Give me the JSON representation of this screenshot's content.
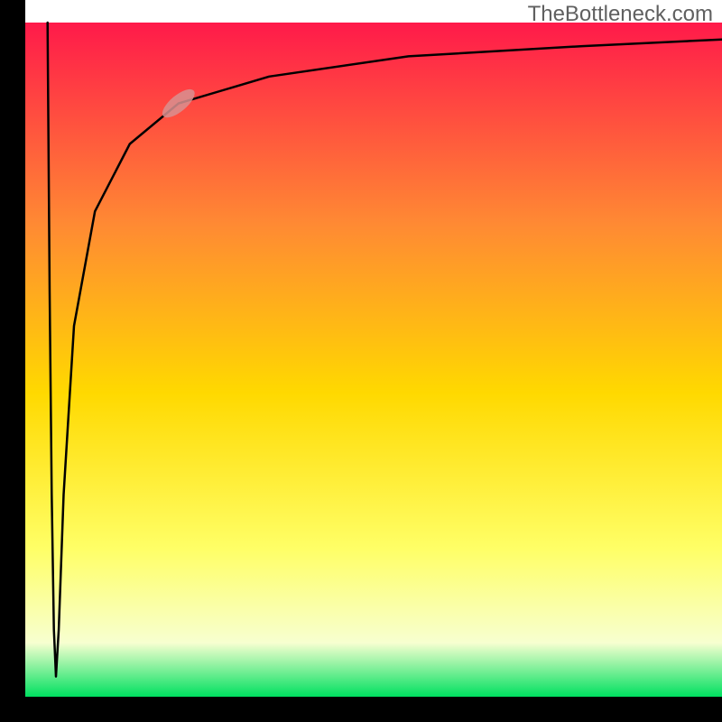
{
  "watermark": "TheBottleneck.com",
  "chart_data": {
    "type": "line",
    "title": "",
    "xlabel": "",
    "ylabel": "",
    "xlim": [
      0,
      100
    ],
    "ylim": [
      0,
      100
    ],
    "background_gradient": {
      "top": "#ff1a4a",
      "upper_mid": "#ff8a33",
      "mid": "#ffd900",
      "lower_mid": "#ffff66",
      "lower": "#f7ffd0",
      "bottom": "#00e060"
    },
    "curve": {
      "description": "Sharp dip from top-left to bottom then logarithmic rise to top-right",
      "points": [
        {
          "x": 3.2,
          "y": 100
        },
        {
          "x": 3.5,
          "y": 60
        },
        {
          "x": 3.8,
          "y": 30
        },
        {
          "x": 4.1,
          "y": 10
        },
        {
          "x": 4.4,
          "y": 3
        },
        {
          "x": 4.8,
          "y": 10
        },
        {
          "x": 5.5,
          "y": 30
        },
        {
          "x": 7.0,
          "y": 55
        },
        {
          "x": 10.0,
          "y": 72
        },
        {
          "x": 15.0,
          "y": 82
        },
        {
          "x": 22.0,
          "y": 88
        },
        {
          "x": 35.0,
          "y": 92
        },
        {
          "x": 55.0,
          "y": 95
        },
        {
          "x": 80.0,
          "y": 96.5
        },
        {
          "x": 100.0,
          "y": 97.5
        }
      ]
    },
    "highlight_marker": {
      "x": 22,
      "y": 88,
      "color": "#d89090"
    },
    "axes": {
      "left": true,
      "bottom": true,
      "color": "#000000",
      "thickness_px": 28
    }
  }
}
